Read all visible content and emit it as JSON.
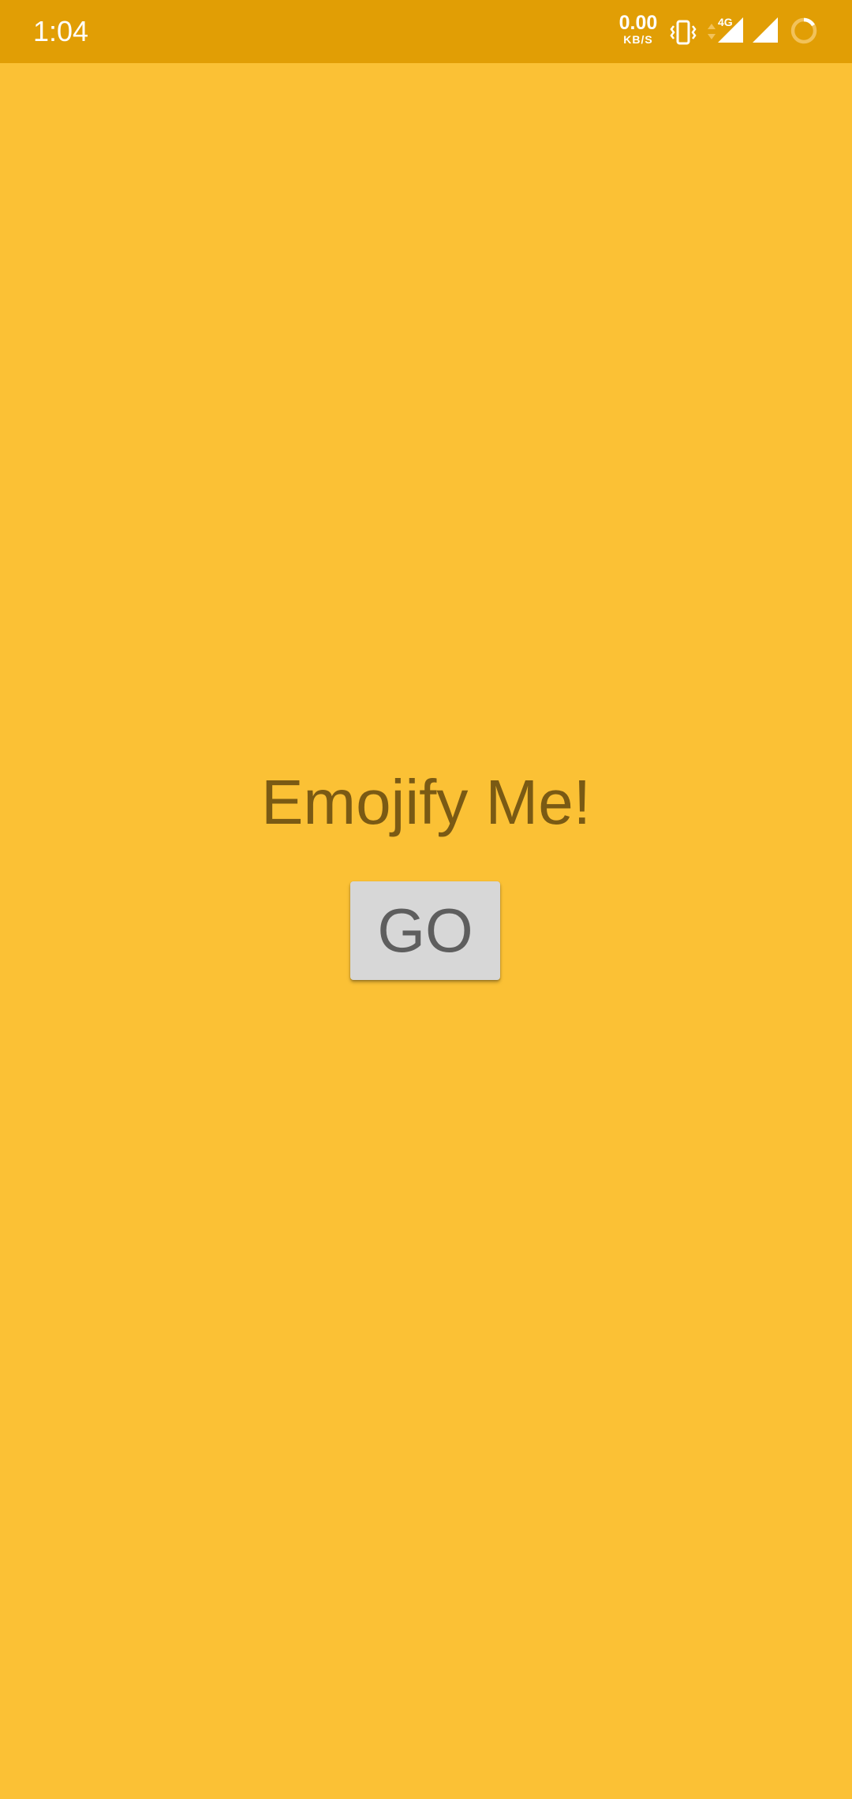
{
  "status_bar": {
    "time": "1:04",
    "net_speed_value": "0.00",
    "net_speed_unit": "KB/S",
    "network_label": "4G",
    "icons": [
      "vibrate-icon",
      "data-arrows-icon",
      "signal-4g-icon",
      "signal-icon",
      "loading-icon"
    ],
    "background_color": "#E19E05"
  },
  "main": {
    "title": "Emojify Me!",
    "go_button_label": "GO",
    "background_color": "#FBC135"
  }
}
